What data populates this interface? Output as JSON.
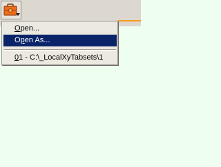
{
  "colors": {
    "background": "#efffef",
    "menu_background": "#ece9e1",
    "highlight": "#0a246a",
    "highlight_text": "#ffffff",
    "toolbar": "#dcd8d0",
    "accent": "#f59a1f"
  },
  "toolbar": {
    "open_button_icon": "briefcase-icon",
    "dropdown_icon": "dropdown-arrow-icon"
  },
  "menu": {
    "items": [
      {
        "mnemonic": "O",
        "rest": "pen..."
      },
      {
        "prefix": "O",
        "mnemonic": "p",
        "rest": "en As..."
      }
    ],
    "recent_files": [
      {
        "mnemonic": "0",
        "rest": "1 - C:\\_LocalXyTabsets\\1"
      }
    ]
  }
}
